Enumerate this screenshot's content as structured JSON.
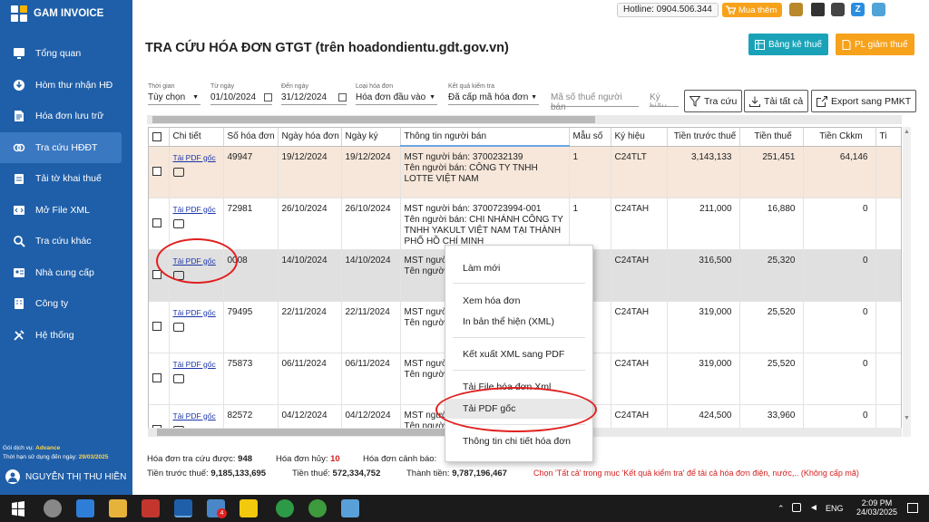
{
  "app": {
    "name": "GAM INVOICE",
    "hotline": "Hotline: 0904.506.344",
    "buy_label": "Mua thêm"
  },
  "sidebar": {
    "items": [
      {
        "label": "Tổng quan",
        "icon": "monitor-icon"
      },
      {
        "label": "Hòm thư nhận HĐ",
        "icon": "download-icon"
      },
      {
        "label": "Hóa đơn lưu trữ",
        "icon": "document-icon"
      },
      {
        "label": "Tra cứu HĐĐT",
        "icon": "link-icon",
        "active": true
      },
      {
        "label": "Tải tờ khai thuế",
        "icon": "clipboard-icon"
      },
      {
        "label": "Mở File XML",
        "icon": "xml-icon"
      },
      {
        "label": "Tra cứu khác",
        "icon": "search-icon"
      },
      {
        "label": "Nhà cung cấp",
        "icon": "supplier-icon"
      },
      {
        "label": "Công ty",
        "icon": "building-icon"
      },
      {
        "label": "Hệ thống",
        "icon": "tools-icon"
      }
    ],
    "service_label": "Gói dịch vụ:",
    "service_value": "Advance",
    "expiry_label": "Thời hạn sử dụng đến ngày:",
    "expiry_value": "29/03/2025",
    "user_name": "NGUYỄN THỊ THU HIỀN"
  },
  "header": {
    "title": "TRA CỨU HÓA ĐƠN GTGT (trên hoadondientu.gdt.gov.vn)",
    "btn_bang_ke": "Bảng kê thuế",
    "btn_pl": "PL giảm thuế"
  },
  "filters": {
    "thoi_gian": {
      "label": "Thời gian",
      "value": "Tùy chọn"
    },
    "tu_ngay": {
      "label": "Từ ngày",
      "value": "01/10/2024"
    },
    "den_ngay": {
      "label": "Đến ngày",
      "value": "31/12/2024"
    },
    "loai_hd": {
      "label": "Loại hóa đơn",
      "value": "Hóa đơn đầu vào"
    },
    "ket_qua": {
      "label": "Kết quả kiểm tra",
      "value": "Đã cấp mã hóa đơn"
    },
    "mst_placeholder": "Mã số thuế người bán",
    "ky_hieu_placeholder": "Ký hiệu"
  },
  "actions": {
    "tra_cuu": "Tra cứu",
    "tai_tat_ca": "Tải tất cả",
    "export": "Export sang PMKT"
  },
  "table": {
    "headers": [
      "Chi tiết",
      "Số hóa đơn",
      "Ngày hóa đơn",
      "Ngày ký",
      "Thông tin người bán",
      "Mẫu số",
      "Ký hiệu",
      "Tiền trước thuế",
      "Tiền thuế",
      "Tiền Ckkm",
      "Ti"
    ],
    "link_label": "Tải PDF gốc",
    "rows": [
      {
        "so": "49947",
        "ngay_hd": "19/12/2024",
        "ngay_ky": "19/12/2024",
        "mst": "MST người bán: 3700232139",
        "ten": "Tên người bán: CÔNG TY TNHH LOTTE VIỆT NAM",
        "mau": "1",
        "ky_hieu": "C24TLT",
        "truoc": "3,143,133",
        "thue": "251,451",
        "ckkm": "64,146"
      },
      {
        "so": "72981",
        "ngay_hd": "26/10/2024",
        "ngay_ky": "26/10/2024",
        "mst": "MST người bán: 3700723994-001",
        "ten": "Tên người bán: CHI NHÁNH CÔNG TY TNHH YAKULT VIỆT NAM TẠI THÀNH PHỐ HỒ CHÍ MINH",
        "mau": "1",
        "ky_hieu": "C24TAH",
        "truoc": "211,000",
        "thue": "16,880",
        "ckkm": "0"
      },
      {
        "so": "0008",
        "ngay_hd": "14/10/2024",
        "ngay_ky": "14/10/2024",
        "mst": "MST người b",
        "ten": "Tên người l TNHH YAK PHỐ HỒ CI",
        "mau": "",
        "ky_hieu": "C24TAH",
        "truoc": "316,500",
        "thue": "25,320",
        "ckkm": "0"
      },
      {
        "so": "79495",
        "ngay_hd": "22/11/2024",
        "ngay_ky": "22/11/2024",
        "mst": "MST người b",
        "ten": "Tên người l TNHH YAK PHỐ HỒ CI",
        "mau": "",
        "ky_hieu": "C24TAH",
        "truoc": "319,000",
        "thue": "25,520",
        "ckkm": "0"
      },
      {
        "so": "75873",
        "ngay_hd": "06/11/2024",
        "ngay_ky": "06/11/2024",
        "mst": "MST người b",
        "ten": "Tên người l TNHH YAK PHỐ HỒ CI",
        "mau": "",
        "ky_hieu": "C24TAH",
        "truoc": "319,000",
        "thue": "25,520",
        "ckkm": "0"
      },
      {
        "so": "82572",
        "ngay_hd": "04/12/2024",
        "ngay_ky": "04/12/2024",
        "mst": "MST người b",
        "ten": "Tên người l",
        "mau": "",
        "ky_hieu": "C24TAH",
        "truoc": "424,500",
        "thue": "33,960",
        "ckkm": "0"
      }
    ]
  },
  "context_menu": {
    "items": [
      "Làm mới",
      "Xem hóa đơn",
      "In bản thể hiện (XML)",
      "Kết xuất XML sang PDF",
      "Tải File hóa đơn Xml",
      "Tải PDF gốc",
      "Thông tin chi tiết hóa đơn"
    ]
  },
  "summary": {
    "tra_cuu_label": "Hóa đơn tra cứu được:",
    "tra_cuu_value": "948",
    "huy_label": "Hóa đơn hủy:",
    "huy_value": "10",
    "canh_bao_label": "Hóa đơn cảnh báo:",
    "truoc_thue_label": "Tiền trước thuế:",
    "truoc_thue_value": "9,185,133,695",
    "thue_label": "Tiền thuế:",
    "thue_value": "572,334,752",
    "thanh_tien_label": "Thành tiền:",
    "thanh_tien_value": "9,787,196,467",
    "note": "Chọn 'Tất cả' trong mục 'Kết quả kiểm tra' để tải cả hóa đơn điện, nước,.. (Không cấp mã)"
  },
  "taskbar": {
    "lang": "ENG",
    "time": "2:09 PM",
    "date": "24/03/2025",
    "badge": "4"
  },
  "colors": {
    "sidebar": "#1f5fa9",
    "accent_teal": "#1aa3b8",
    "accent_orange": "#f7a21b",
    "highlight_row": "#f6e7da",
    "annotation": "#e02020"
  }
}
